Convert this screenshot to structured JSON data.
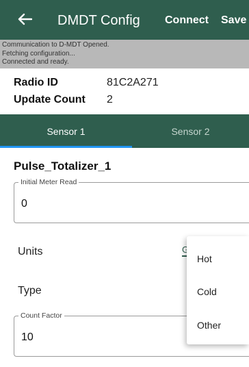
{
  "appbar": {
    "title": "DMDT Config",
    "connect_label": "Connect",
    "save_label": "Save"
  },
  "log": {
    "lines": [
      "Communication to D-MDT Opened.",
      "Fetching configuration...",
      "Connected and ready."
    ]
  },
  "info": {
    "radio_id_label": "Radio ID",
    "radio_id_value": "81C2A271",
    "update_count_label": "Update Count",
    "update_count_value": "2"
  },
  "tabs": [
    {
      "label": "Sensor 1",
      "selected": true
    },
    {
      "label": "Sensor 2",
      "selected": false
    }
  ],
  "sensor": {
    "name": "Pulse_Totalizer_1",
    "initial_meter_read_label": "Initial Meter Read",
    "initial_meter_read_value": "0",
    "units_label": "Units",
    "units_value_partial": "G",
    "type_label": "Type",
    "count_factor_label": "Count Factor",
    "count_factor_value": "10"
  },
  "dropdown": {
    "options": [
      "Hot",
      "Cold",
      "Other"
    ]
  },
  "colors": {
    "appbar": "#2f5e4e",
    "tab_indicator": "#2196f3",
    "log_background": "#b8b8b8"
  },
  "icons": {
    "back": "arrow-left-icon"
  }
}
